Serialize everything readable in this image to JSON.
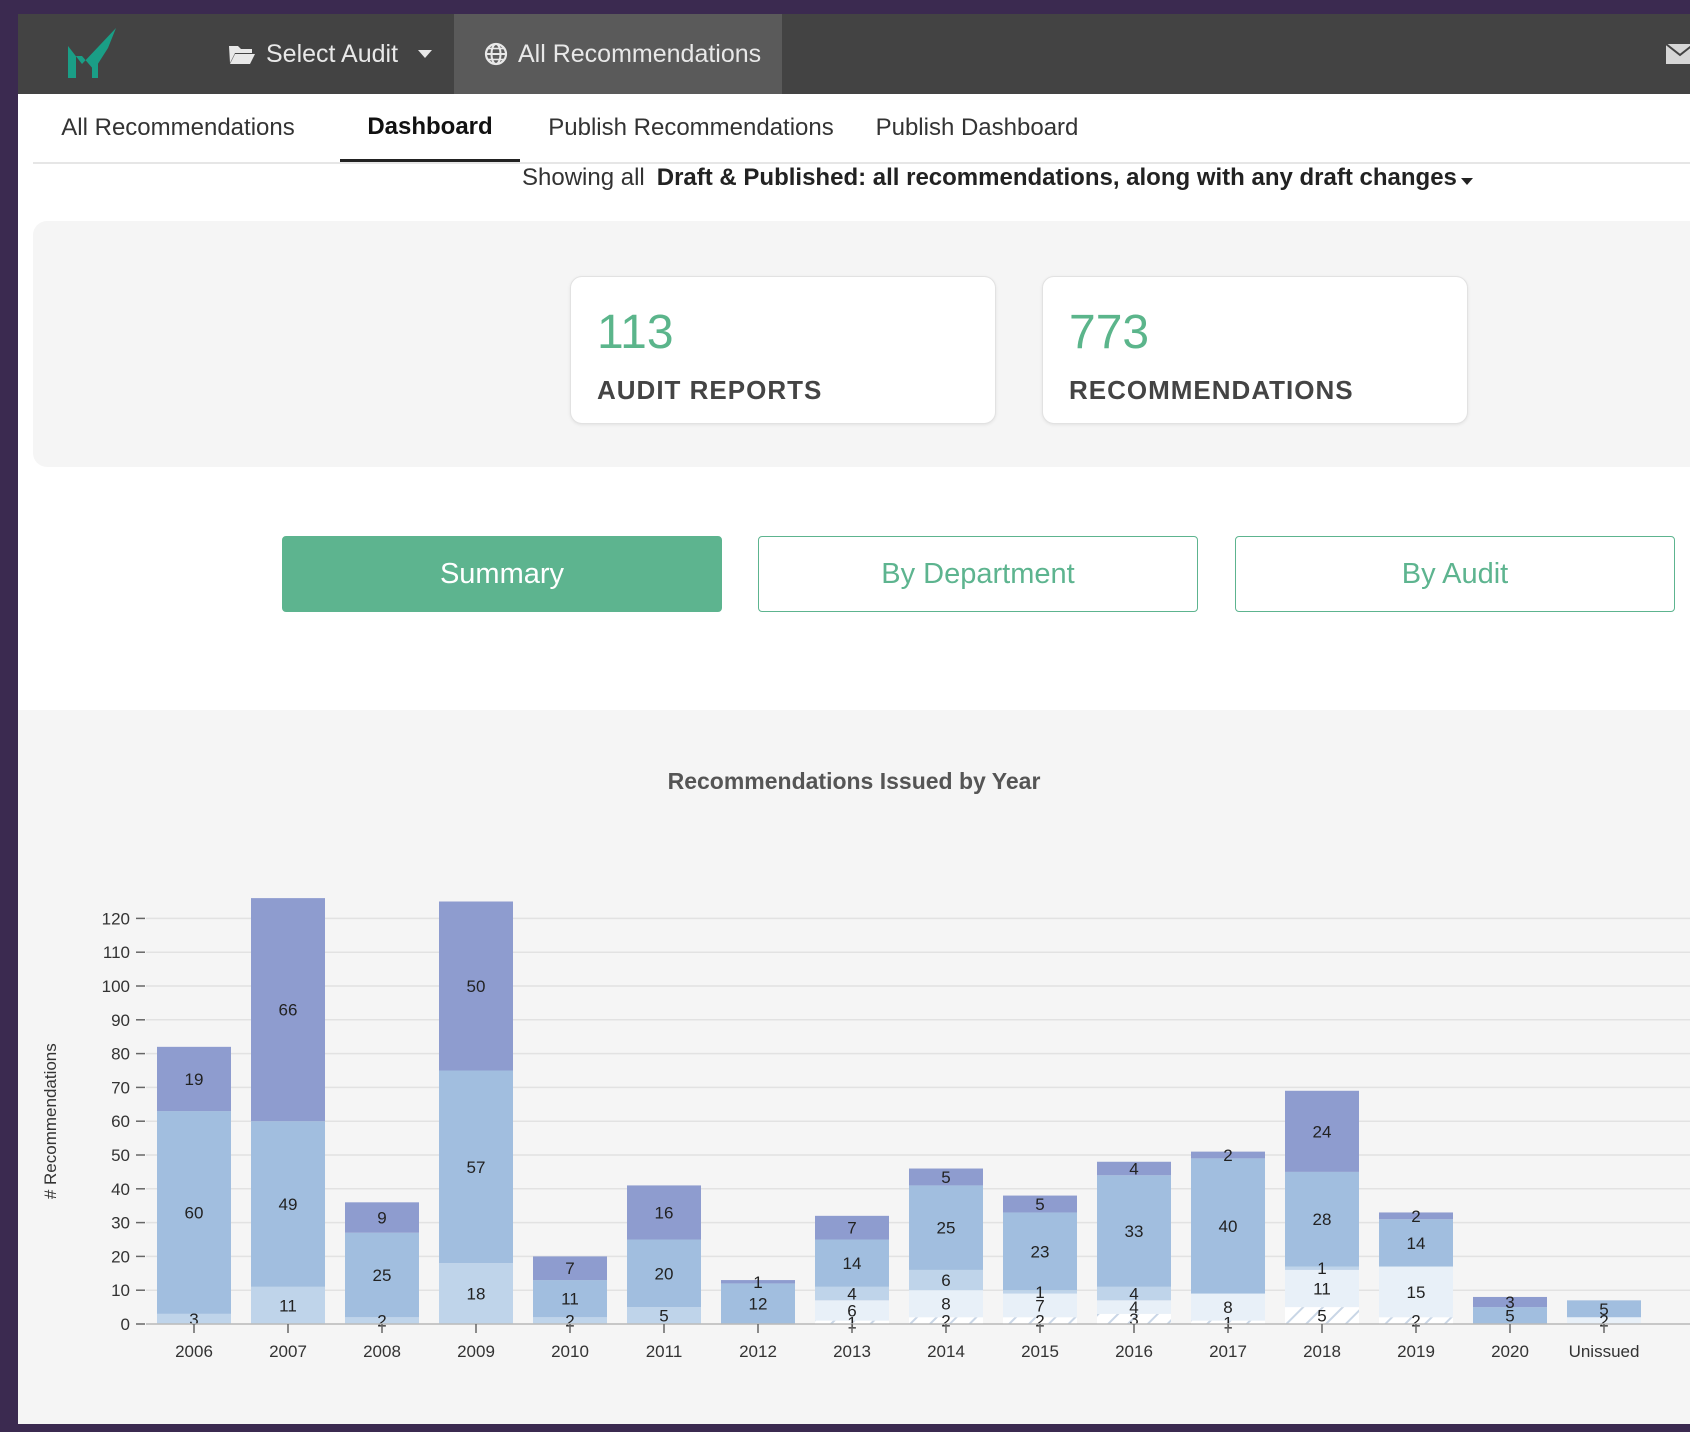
{
  "topbar": {
    "select_audit": "Select Audit",
    "all_recommendations": "All Recommendations"
  },
  "tabs": [
    {
      "label": "All Recommendations"
    },
    {
      "label": "Dashboard"
    },
    {
      "label": "Publish Recommendations"
    },
    {
      "label": "Publish Dashboard"
    }
  ],
  "filter": {
    "prefix": "Showing all",
    "selected": "Draft & Published: all recommendations, along with any draft changes"
  },
  "stats": [
    {
      "value": "113",
      "label": "AUDIT REPORTS"
    },
    {
      "value": "773",
      "label": "RECOMMENDATIONS"
    }
  ],
  "view_buttons": [
    {
      "label": "Summary"
    },
    {
      "label": "By Department"
    },
    {
      "label": "By Audit"
    }
  ],
  "colors": {
    "accent": "#5db48f",
    "stat_value": "#5bb58b",
    "series": [
      "#e8f0f8",
      "#bfd4ea",
      "#a1bedf",
      "#8e9ccf"
    ]
  },
  "chart_data": {
    "type": "bar",
    "stacked": true,
    "title": "Recommendations Issued by Year",
    "xlabel": "",
    "ylabel": "# Recommendations",
    "ylim": [
      0,
      120
    ],
    "yticks": [
      0,
      10,
      20,
      30,
      40,
      50,
      60,
      70,
      80,
      90,
      100,
      110,
      120
    ],
    "grid": true,
    "categories": [
      "2006",
      "2007",
      "2008",
      "2009",
      "2010",
      "2011",
      "2012",
      "2013",
      "2014",
      "2015",
      "2016",
      "2017",
      "2018",
      "2019",
      "2020",
      "Unissued"
    ],
    "series": [
      {
        "values": [
          0,
          0,
          0,
          0,
          0,
          0,
          0,
          1,
          2,
          2,
          3,
          1,
          5,
          2,
          0,
          0
        ]
      },
      {
        "values": [
          0,
          0,
          0,
          0,
          0,
          0,
          0,
          6,
          8,
          7,
          4,
          8,
          11,
          15,
          0,
          2
        ]
      },
      {
        "values": [
          3,
          11,
          2,
          18,
          2,
          5,
          0,
          4,
          6,
          1,
          4,
          0,
          1,
          0,
          0,
          0
        ]
      },
      {
        "values": [
          60,
          49,
          25,
          57,
          11,
          20,
          12,
          14,
          25,
          23,
          33,
          40,
          28,
          14,
          5,
          5
        ]
      },
      {
        "values": [
          19,
          66,
          9,
          50,
          7,
          16,
          1,
          7,
          5,
          5,
          4,
          2,
          24,
          2,
          3,
          0
        ]
      }
    ]
  }
}
